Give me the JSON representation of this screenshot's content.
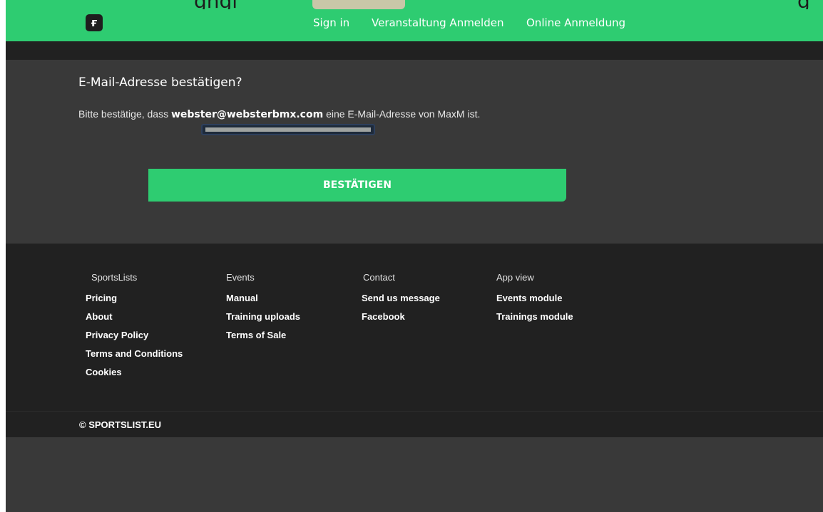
{
  "navbar": {
    "logo_glyph": "ғ",
    "links": [
      "Sign in",
      "Veranstaltung Anmelden",
      "Online Anmeldung"
    ],
    "cutoff_text": [
      " gngi",
      "g"
    ]
  },
  "confirm": {
    "title": "E-Mail-Adresse bestätigen?",
    "text_before": "Bitte bestätige, dass ",
    "email": "webster@websterbmx.com",
    "text_after": " eine E-Mail-Adresse von MaxM ist.",
    "button": "BESTÄTIGEN"
  },
  "footer": {
    "columns": [
      {
        "heading": "SportsLists",
        "links": [
          "Pricing",
          "About",
          "Privacy Policy",
          "Terms and Conditions",
          "Cookies"
        ]
      },
      {
        "heading": "Events",
        "links": [
          "Manual",
          "Training uploads",
          "Terms of Sale"
        ]
      },
      {
        "heading": "Contact",
        "links": [
          "Send us message",
          "Facebook"
        ]
      },
      {
        "heading": "App view",
        "links": [
          "Events module",
          "Trainings module"
        ]
      }
    ],
    "copyright": "© SPORTSLIST.EU"
  },
  "colors": {
    "brand_green": "#2ecc71",
    "dark_bg": "#212121",
    "panel_bg": "#393939"
  }
}
